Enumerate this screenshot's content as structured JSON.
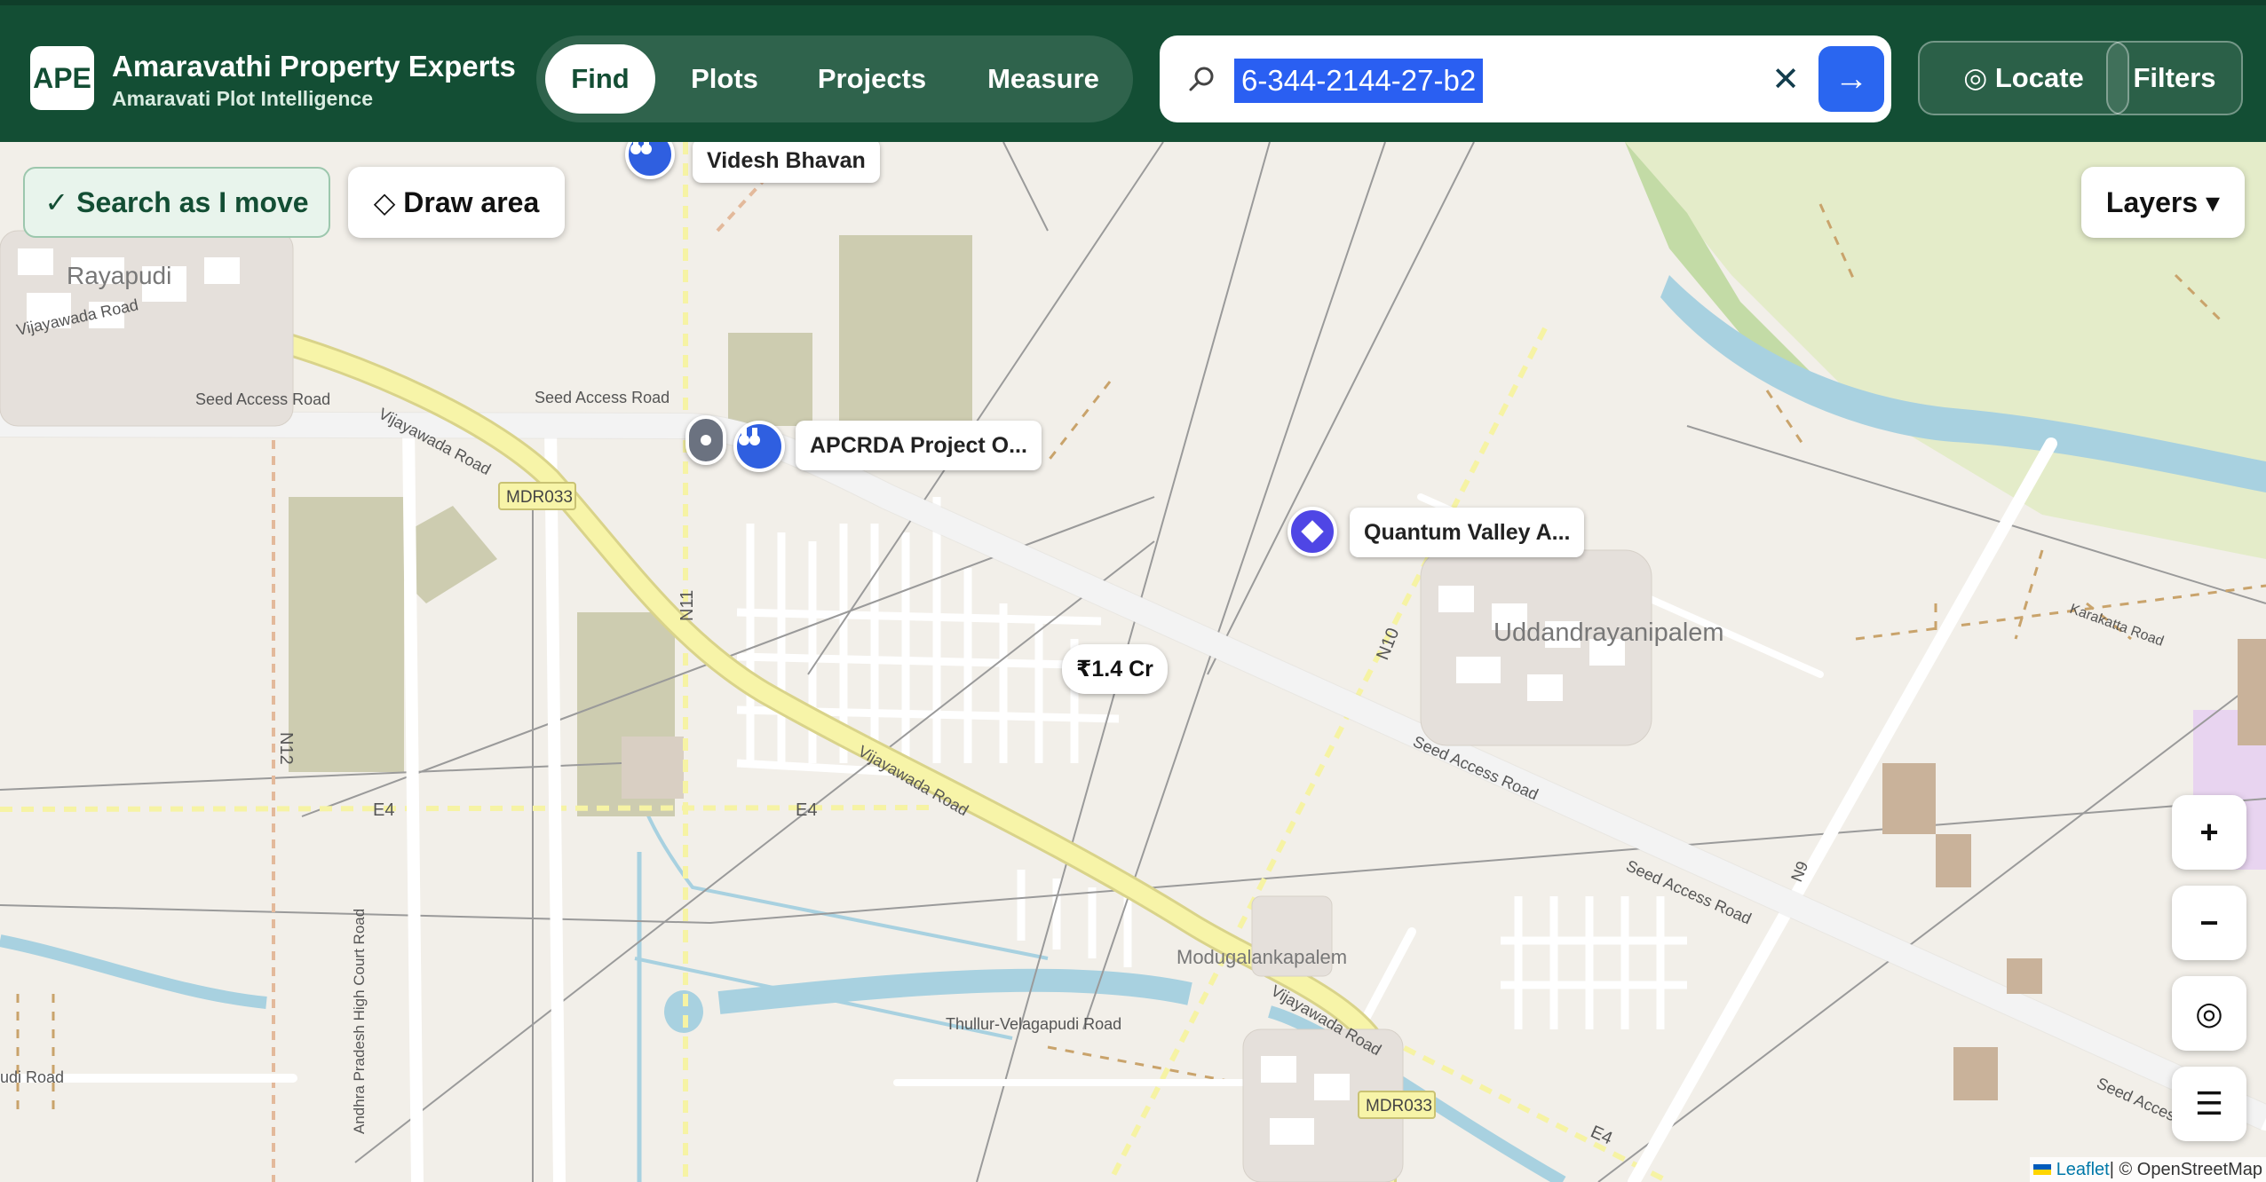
{
  "brand": {
    "logo": "APE",
    "title": "Amaravathi Property Experts",
    "subtitle": "Amaravati Plot Intelligence"
  },
  "nav": {
    "items": [
      "Find",
      "Plots",
      "Projects",
      "Measure"
    ],
    "active": "Find"
  },
  "search": {
    "value": "6-344-2144-27-b2",
    "icon": "search-icon",
    "clear_label": "✕",
    "go_label": "→"
  },
  "header_buttons": {
    "locate": "◎ Locate",
    "filters": "Filters"
  },
  "map_controls": {
    "search_as_move": "✓ Search as I move",
    "draw_area": "◇ Draw area",
    "layers": "Layers ▾",
    "zoom_in": "+",
    "zoom_out": "−",
    "locate": "◎",
    "menu": "☰"
  },
  "pins": {
    "videsh": "Videsh Bhavan",
    "apcrda": "APCRDA Project O...",
    "quantum": "Quantum Valley A...",
    "price": "₹1.4 Cr"
  },
  "map_labels": {
    "rayapudi": "Rayapudi",
    "uddandrayanipalem": "Uddandrayanipalem",
    "modugalankapalem": "Modugalankapalem",
    "vijayawada_road": "Vijayawada Road",
    "seed_access_road": "Seed Access Road",
    "mdr033": "MDR033",
    "n11": "N11",
    "n12": "N12",
    "n10": "N10",
    "n9": "N9",
    "e4": "E4",
    "thullur": "Thullur-Velagapudi Road",
    "high_court": "Andhra Pradesh High Court Road",
    "karakatta": "Karakatta Road",
    "udi_road": "udi Road",
    "seed_acces_trunc": "Seed Acces"
  },
  "attribution": {
    "leaflet": "Leaflet",
    "rest": " | © OpenStreetMap"
  },
  "colors": {
    "header": "#134e34",
    "accent": "#2a66f0",
    "map_bg": "#f2efe9"
  }
}
